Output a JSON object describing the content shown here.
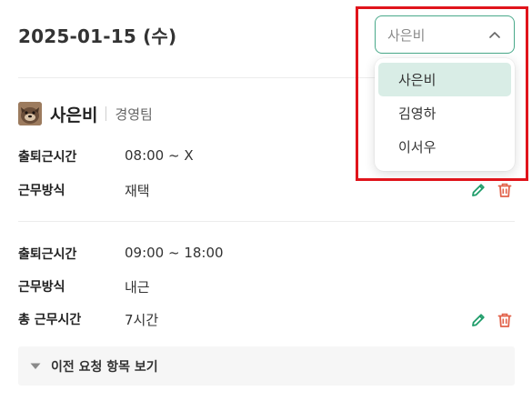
{
  "header": {
    "date": "2025-01-15 (수)"
  },
  "employee_select": {
    "selected_value": "사은비",
    "options": [
      "사은비",
      "김영하",
      "이서우"
    ]
  },
  "user": {
    "name": "사은비",
    "team": "경영팀"
  },
  "record_1": {
    "attendance_label": "출퇴근시간",
    "attendance_value": "08:00 ~ X",
    "work_type_label": "근무방식",
    "work_type_value": "재택"
  },
  "record_2": {
    "attendance_label": "출퇴근시간",
    "attendance_value": "09:00 ~ 18:00",
    "work_type_label": "근무방식",
    "work_type_value": "내근",
    "total_label": "총 근무시간",
    "total_value": "7시간"
  },
  "history": {
    "label": "이전 요청 항목 보기"
  },
  "icons": {
    "edit": "pencil-icon",
    "delete": "trash-icon",
    "chevron": "chevron-up-icon",
    "expand": "caret-down-icon"
  },
  "colors": {
    "accent": "#49a98a",
    "selected_bg": "#d9ede6",
    "danger": "#e2624a",
    "edit_green": "#1f9d6a",
    "highlight": "#e0141b"
  }
}
